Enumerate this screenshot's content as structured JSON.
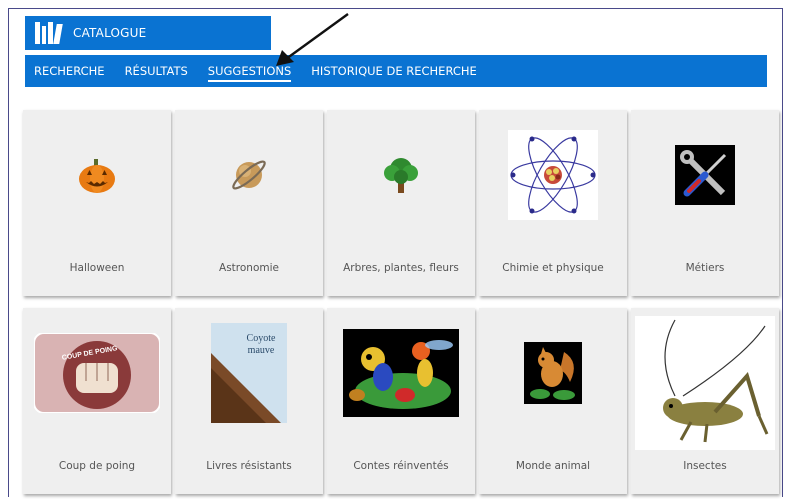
{
  "header": {
    "title": "CATALOGUE",
    "logo_icon": "books-icon",
    "brand_color": "#0a73d2"
  },
  "nav": {
    "items": [
      {
        "label": "RECHERCHE",
        "active": false
      },
      {
        "label": "RÉSULTATS",
        "active": false
      },
      {
        "label": "SUGGESTIONS",
        "active": true
      },
      {
        "label": "HISTORIQUE DE RECHERCHE",
        "active": false
      }
    ]
  },
  "annotation": {
    "icon": "arrow-icon",
    "points_to": "SUGGESTIONS"
  },
  "cards": [
    {
      "label": "Halloween",
      "icon": "pumpkin-icon"
    },
    {
      "label": "Astronomie",
      "icon": "planet-icon"
    },
    {
      "label": "Arbres, plantes, fleurs",
      "icon": "tree-icon"
    },
    {
      "label": "Chimie et physique",
      "icon": "atom-icon"
    },
    {
      "label": "Métiers",
      "icon": "tools-icon"
    },
    {
      "label": "Coup de poing",
      "icon": "fist-icon"
    },
    {
      "label": "Livres résistants",
      "icon": "book-cover-icon"
    },
    {
      "label": "Contes réinventés",
      "icon": "insects-cartoon-icon"
    },
    {
      "label": "Monde animal",
      "icon": "squirrel-icon"
    },
    {
      "label": "Insectes",
      "icon": "cricket-icon"
    }
  ],
  "card_art_text": {
    "fist_title": "COUP DE POING",
    "book_title_1": "Coyote",
    "book_title_2": "mauve"
  }
}
